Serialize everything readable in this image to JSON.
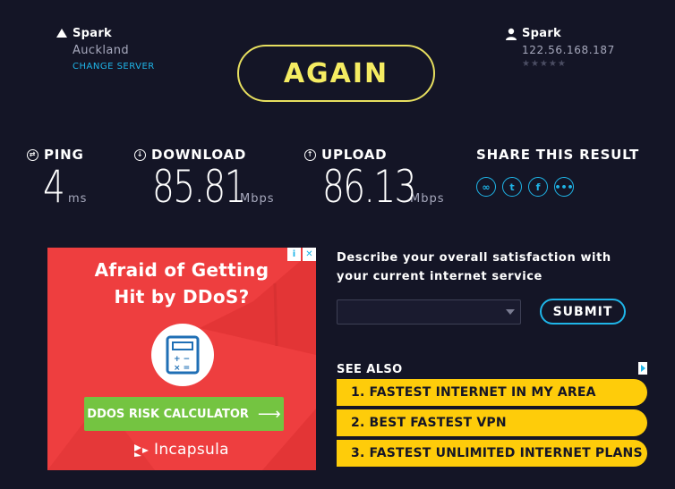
{
  "server": {
    "provider": "Spark",
    "city": "Auckland",
    "change_label": "CHANGE SERVER"
  },
  "client": {
    "isp": "Spark",
    "ip": "122.56.168.187",
    "stars": "★★★★★"
  },
  "again_label": "AGAIN",
  "ping": {
    "label": "PING",
    "value": "4",
    "unit": "ms"
  },
  "download": {
    "label": "DOWNLOAD",
    "value": "85.81",
    "unit": "Mbps"
  },
  "upload": {
    "label": "UPLOAD",
    "value": "86.13",
    "unit": "Mbps"
  },
  "share": {
    "label": "SHARE THIS RESULT",
    "icons": [
      "link-icon",
      "twitter-icon",
      "facebook-icon",
      "more-icon"
    ]
  },
  "ad": {
    "headline_line1": "Afraid of Getting",
    "headline_line2": "Hit by DDoS?",
    "cta": "DDOS RISK CALCULATOR",
    "brand": "Incapsula",
    "background": "#ee3e3f",
    "cta_color": "#74c441"
  },
  "survey": {
    "question": "Describe your overall satisfaction with your current internet service",
    "select_value": "",
    "submit_label": "SUBMIT"
  },
  "see_also": {
    "title": "SEE ALSO",
    "items": [
      "1.  FASTEST INTERNET IN MY AREA",
      "2.  BEST FASTEST VPN",
      "3.  FASTEST UNLIMITED INTERNET PLANS"
    ]
  },
  "colors": {
    "accent_yellow": "#f5ec62",
    "accent_blue": "#1fb5e8",
    "background": "#141526",
    "link_yellow": "#fecc0a"
  }
}
